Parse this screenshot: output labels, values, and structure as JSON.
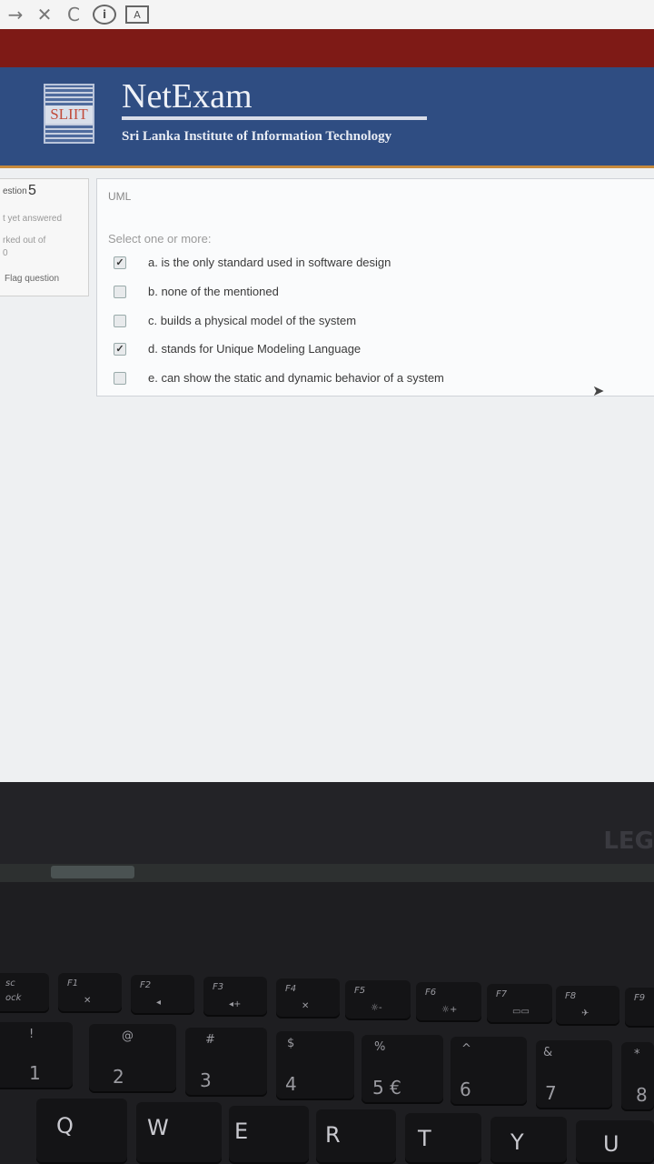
{
  "browser": {
    "back_glyph": "→",
    "close_glyph": "✕",
    "reload_glyph": "C",
    "info_glyph": "i",
    "page_glyph": "A"
  },
  "header": {
    "logo_text": "SLIIT",
    "brand": "NetExam",
    "subtitle": "Sri Lanka Institute of Information Technology"
  },
  "question_info": {
    "label": "estion",
    "number": "5",
    "state": "t yet answered",
    "marked": "rked out of",
    "marked_value": "0",
    "flag": "Flag question"
  },
  "question": {
    "category": "UML",
    "prompt": "Select one or more:",
    "options": [
      {
        "text": "a. is the only standard used in software design",
        "checked": true
      },
      {
        "text": "b. none of the mentioned",
        "checked": false
      },
      {
        "text": "c. builds a physical model of the system",
        "checked": false
      },
      {
        "text": "d. stands for Unique Modeling Language",
        "checked": true
      },
      {
        "text": "e. can show the static and dynamic behavior of a system",
        "checked": false
      }
    ]
  },
  "laptop": {
    "brand": "LEG"
  },
  "keyboard": {
    "fn_row": [
      {
        "label": "sc",
        "sub": "ock"
      },
      {
        "label": "F1"
      },
      {
        "label": "F2"
      },
      {
        "label": "F3"
      },
      {
        "label": "F4"
      },
      {
        "label": "F5"
      },
      {
        "label": "F6"
      },
      {
        "label": "F7"
      },
      {
        "label": "F8"
      },
      {
        "label": "F9"
      }
    ],
    "num_row": [
      {
        "shift": "!",
        "main": "1"
      },
      {
        "shift": "@",
        "main": "2"
      },
      {
        "shift": "#",
        "main": "3"
      },
      {
        "shift": "$",
        "main": "4"
      },
      {
        "shift": "%",
        "main": "5 €"
      },
      {
        "shift": "^",
        "main": "6"
      },
      {
        "shift": "&",
        "main": "7"
      },
      {
        "shift": "*",
        "main": "8"
      }
    ],
    "letter_row": [
      "Q",
      "W",
      "E",
      "R",
      "T",
      "Y",
      "U"
    ]
  }
}
